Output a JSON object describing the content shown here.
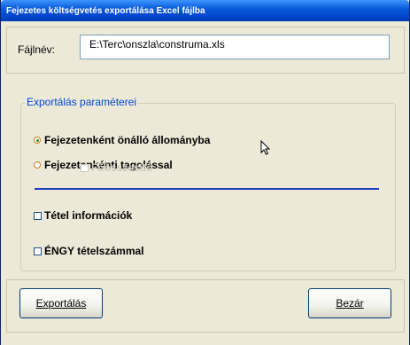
{
  "window": {
    "title": "Fejezetes költségvetés exportálása Excel fájlba"
  },
  "file": {
    "label": "Fájlnév:",
    "value": "E:\\Terc\\onszla\\construma.xls"
  },
  "group": {
    "legend": "Exportálás paraméterei",
    "radio_own_file": {
      "label": "Fejezetenként önálló állományba",
      "selected": true
    },
    "radio_sections": {
      "label": "Fejezetenkénti tagolással",
      "selected": false
    },
    "check_summary": {
      "label": "Főösszesítő",
      "checked": false,
      "enabled": false
    },
    "check_item_info": {
      "label": "Tétel információk",
      "checked": false
    },
    "check_engy": {
      "label": "ÉNGY tételszámmal",
      "checked": false
    }
  },
  "buttons": {
    "export": "Exportálás",
    "close": "Bezár"
  },
  "icons": {
    "cursor": "mouse-pointer-icon"
  },
  "colors": {
    "title_bar": "#0a5bd9",
    "legend": "#0046d5",
    "window": "#ece9d8"
  }
}
